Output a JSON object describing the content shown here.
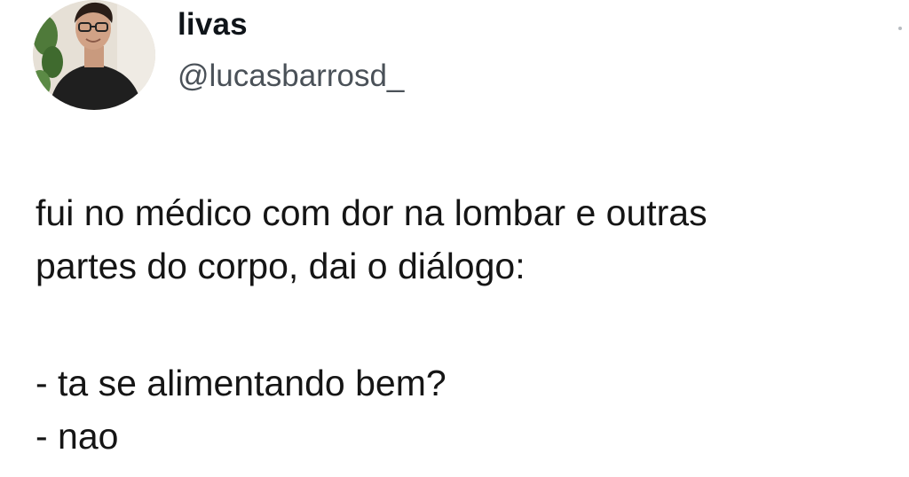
{
  "author": {
    "display_name": "livas",
    "handle": "@lucasbarrosd_",
    "avatar_icon": "profile-photo-icon"
  },
  "tweet": {
    "lines": [
      "fui no médico com dor na lombar e outras",
      "partes do corpo, dai o diálogo:",
      "- ta se alimentando bem?",
      "- nao"
    ]
  },
  "colors": {
    "background": "#ffffff",
    "text": "#0f1419",
    "handle": "#4a5158"
  }
}
